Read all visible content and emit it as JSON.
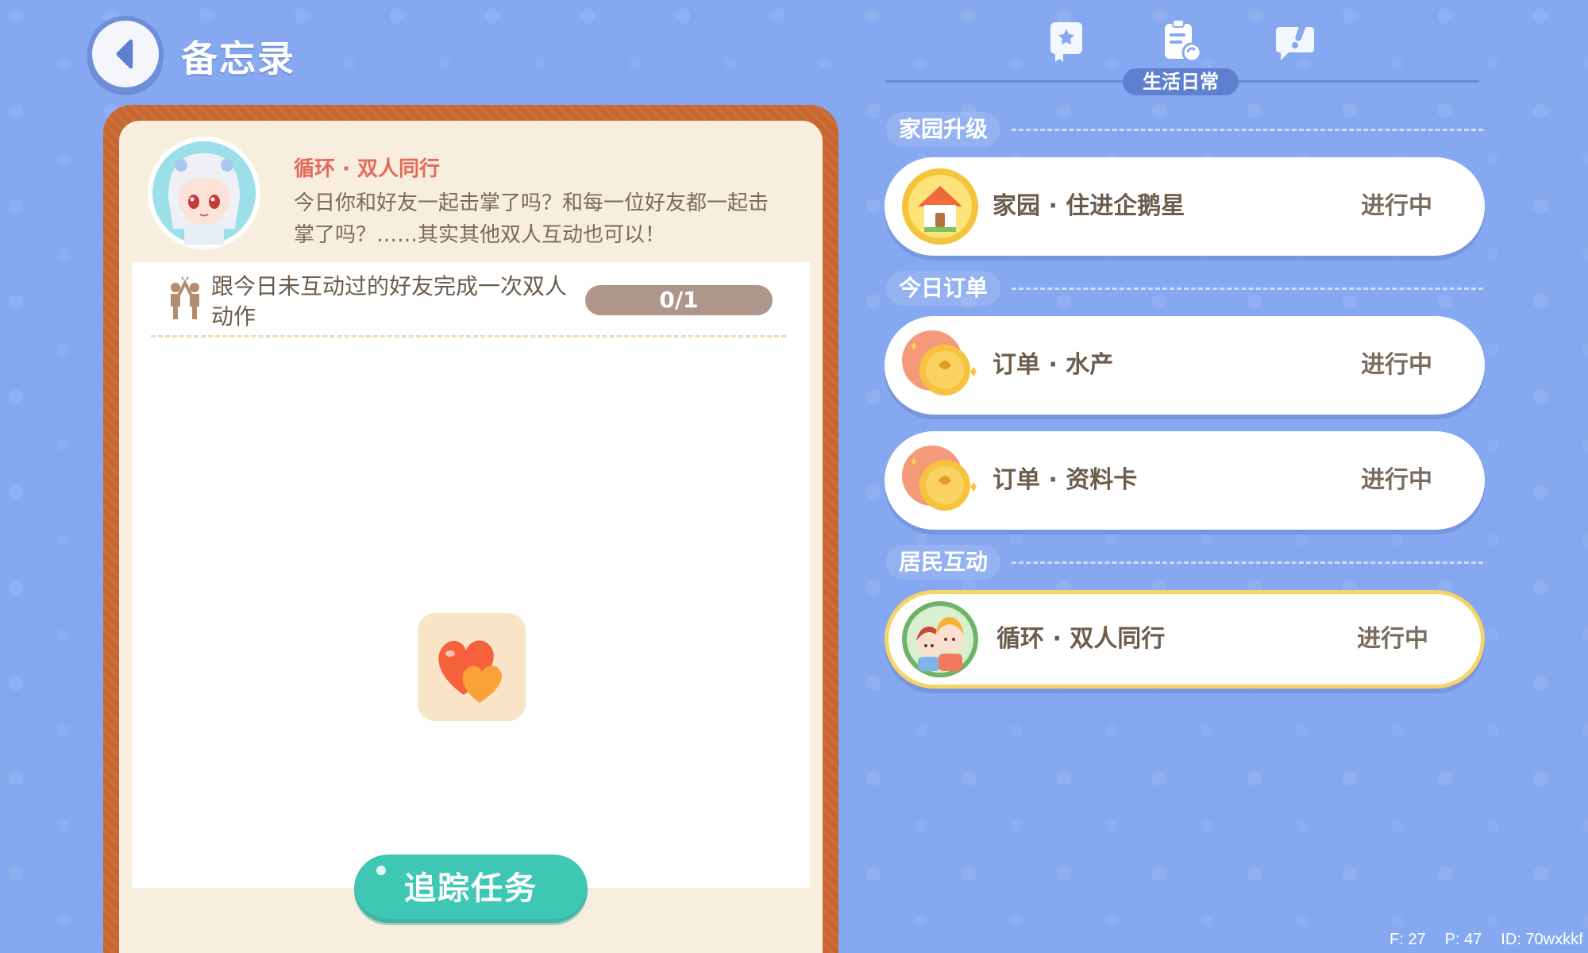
{
  "header": {
    "title": "备忘录"
  },
  "tabs": {
    "active_label": "生活日常"
  },
  "quest_detail": {
    "name": "循环 · 双人同行",
    "description": "今日你和好友一起击掌了吗？和每一位好友都一起击掌了吗？……其实其他双人互动也可以！",
    "requirement": "跟今日未互动过的好友完成一次双人动作",
    "progress_text": "0/1",
    "progress_fraction": 0,
    "track_button": "追踪任务"
  },
  "sections": [
    {
      "label": "家园升级",
      "cards": [
        {
          "title": "家园 · 住进企鹅星",
          "status": "进行中",
          "icon": "house-icon"
        }
      ]
    },
    {
      "label": "今日订单",
      "cards": [
        {
          "title": "订单 · 水产",
          "status": "进行中",
          "icon": "gold-coin-icon"
        },
        {
          "title": "订单 · 资料卡",
          "status": "进行中",
          "icon": "gold-coin-icon"
        }
      ]
    },
    {
      "label": "居民互动",
      "cards": [
        {
          "title": "循环 · 双人同行",
          "status": "进行中",
          "icon": "two-friends-icon",
          "selected": true
        }
      ]
    }
  ],
  "footer": {
    "f": "F: 27",
    "p": "P: 47",
    "id": "ID: 70wxkkf"
  },
  "colors": {
    "background": "#86a8f0",
    "accent_teal": "#3fc7b6",
    "frame": "#c8662f",
    "quest_name": "#e46a5a",
    "selected_border": "#f6d46a"
  }
}
